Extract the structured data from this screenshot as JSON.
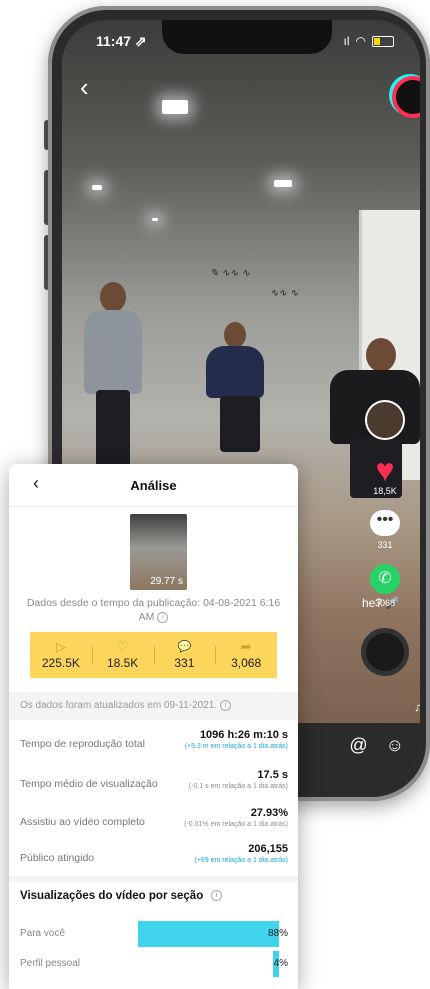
{
  "phone": {
    "status": {
      "time": "11:47 ⇗",
      "signal": "ıl"
    },
    "side_actions": {
      "likes": "18,5K",
      "comments": "331",
      "shares": "3068"
    },
    "caption_fragment": "he? 🎤"
  },
  "analysis": {
    "title": "Análise",
    "thumbnail_duration": "29.77 s",
    "published_note": "Dados desde o tempo da publicação: 04-08-2021 6:16 AM",
    "stats": [
      {
        "icon": "play-icon",
        "glyph": "▷",
        "value": "225.5K"
      },
      {
        "icon": "heart-icon",
        "glyph": "♡",
        "value": "18.5K"
      },
      {
        "icon": "comment-icon",
        "glyph": "💬",
        "value": "331"
      },
      {
        "icon": "share-icon",
        "glyph": "➦",
        "value": "3,068"
      }
    ],
    "updated_note": "Os dados foram atualizados em 09-11-2021.",
    "metrics": [
      {
        "label": "Tempo de reprodução total",
        "value": "1096 h:26 m:10 s",
        "delta": "(+5.3 m em relação a 1 dia atrás)",
        "delta_color": "blue"
      },
      {
        "label": "Tempo médio de visualização",
        "value": "17.5 s",
        "delta": "(-0.1 s em relação a 1 dia atrás)",
        "delta_color": "gray"
      },
      {
        "label": "Assistiu ao vídeo completo",
        "value": "27.93%",
        "delta": "(-0.01% em relação a 1 dia atrás)",
        "delta_color": "gray"
      },
      {
        "label": "Público atingido",
        "value": "206,155",
        "delta": "(+69 em relação a 1 dia atrás)",
        "delta_color": "blue"
      }
    ],
    "views_section_title": "Visualizações do vídeo por seção",
    "views_by_section": [
      {
        "label": "Para você",
        "percent": 88,
        "percent_label": "88%"
      },
      {
        "label": "Perfil pessoal",
        "percent": 4,
        "percent_label": "4%"
      }
    ],
    "colors": {
      "stats_bg": "#fbd65a",
      "bar": "#3fd3ec",
      "delta_blue": "#19a8e8"
    }
  }
}
